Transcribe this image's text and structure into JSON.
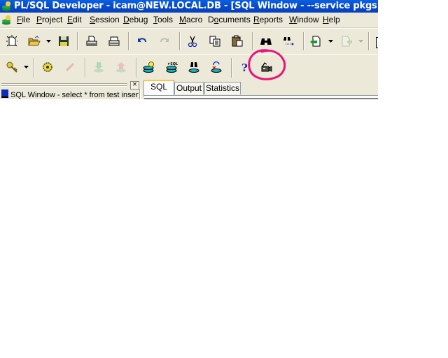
{
  "window": {
    "title": "PL/SQL Developer - icam@NEW.LOCAL.DB - [SQL Window - --service pkgs SELECT MV."
  },
  "menu": {
    "items": [
      {
        "label": "File",
        "mnemonic": "F"
      },
      {
        "label": "Project",
        "mnemonic": "P"
      },
      {
        "label": "Edit",
        "mnemonic": "E"
      },
      {
        "label": "Session",
        "mnemonic": "S"
      },
      {
        "label": "Debug",
        "mnemonic": "D"
      },
      {
        "label": "Tools",
        "mnemonic": "T"
      },
      {
        "label": "Macro",
        "mnemonic": "M"
      },
      {
        "label": "Documents",
        "mnemonic": "o"
      },
      {
        "label": "Reports",
        "mnemonic": "R"
      },
      {
        "label": "Window",
        "mnemonic": "W"
      },
      {
        "label": "Help",
        "mnemonic": "H"
      }
    ]
  },
  "toolbar1": {
    "buttons": [
      "new",
      "open",
      "save",
      "print",
      "print-setup",
      "undo",
      "redo",
      "cut",
      "copy",
      "paste",
      "find",
      "find-next",
      "load",
      "save-file"
    ]
  },
  "toolbar2": {
    "buttons": [
      "log-on",
      "compile",
      "disabled-connect",
      "import",
      "export",
      "query-builder",
      "execute-sql",
      "find-db-objects",
      "refresh-disconnect",
      "help",
      "recorder"
    ]
  },
  "windowlist": {
    "close_label": "×",
    "items": [
      {
        "label": "SQL Window - select * from test insert"
      }
    ]
  },
  "tabs": [
    {
      "label": "SQL",
      "active": true
    },
    {
      "label": "Output",
      "active": false
    },
    {
      "label": "Statistics",
      "active": false
    }
  ],
  "colors": {
    "titlebar": "#0848c8",
    "chrome": "#ece9d8",
    "annotation": "#e8147c",
    "active_tab_accent": "#ffc83c"
  }
}
